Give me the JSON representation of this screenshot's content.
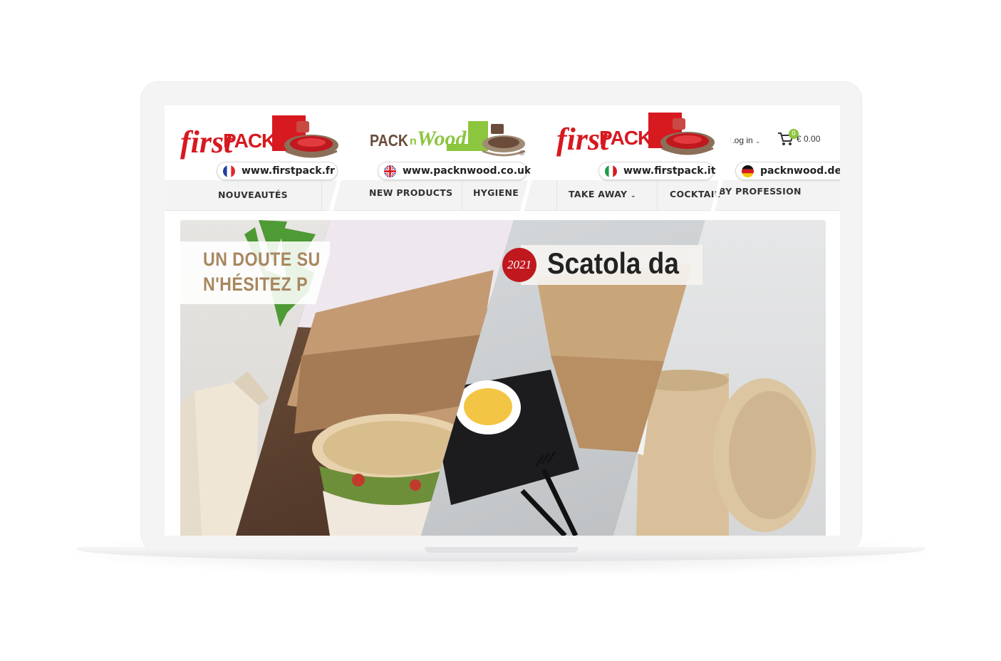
{
  "sites": [
    {
      "brand": "firstPACK",
      "brand_first": "first",
      "brand_pack": "PACK",
      "url": "www.firstpack.fr",
      "flag": "fr-flag",
      "nav": [
        "NOUVEAUTÉS"
      ],
      "hero_lines": [
        "UN DOUTE SU",
        "N'HÉSITEZ P"
      ]
    },
    {
      "brand": "PACKnWood",
      "brand_pack": "PACK",
      "brand_n": "n",
      "brand_wood": "Wood",
      "brand_reg": "®",
      "url": "www.packnwood.co.uk",
      "flag": "uk-flag",
      "nav": [
        "NEW PRODUCTS",
        "HYGIENE"
      ]
    },
    {
      "brand": "firstPACK",
      "brand_first": "first",
      "brand_pack": "PACK",
      "url": "www.firstpack.it",
      "flag": "it-flag",
      "nav": [
        "TAKE AWAY",
        "COCKTAIL"
      ],
      "hero_year": "2021",
      "hero_title": "Scatola da"
    },
    {
      "url": "packnwood.de",
      "flag": "de-flag",
      "nav": [
        "BY PROFESSION"
      ],
      "login": "Log in",
      "cart_count": "0",
      "cart_total": "€ 0.00"
    }
  ],
  "colors": {
    "firstpack_red": "#d71920",
    "packnwood_green": "#8cc63f",
    "packnwood_brown": "#6b4c3b",
    "nav_bg": "#f3f3f3",
    "badge_red": "#c0181f",
    "banner_gold": "#a8875f"
  },
  "icons": [
    "chevron-down-icon",
    "cart-icon",
    "fr-flag",
    "uk-flag",
    "it-flag",
    "de-flag"
  ]
}
